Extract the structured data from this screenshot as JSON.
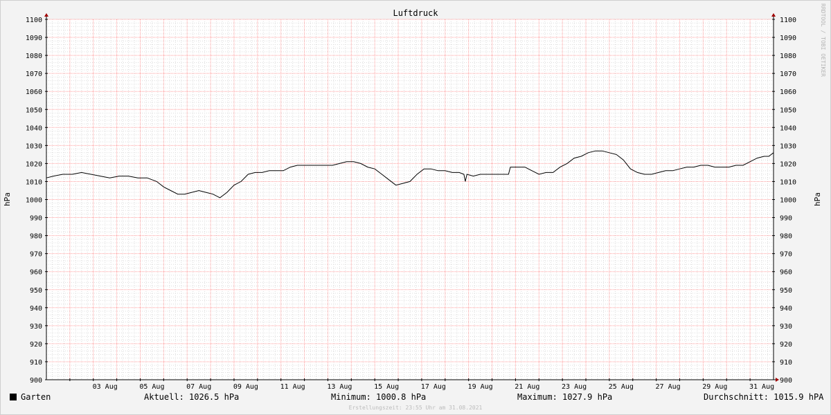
{
  "chart_data": {
    "type": "line",
    "title": "Luftdruck",
    "ylabel_left": "hPa",
    "ylabel_right": "hPa",
    "watermark": "RRDTOOL / TOBI OETIKER",
    "ylim": [
      900,
      1100
    ],
    "yticks": [
      900,
      910,
      920,
      930,
      940,
      950,
      960,
      970,
      980,
      990,
      1000,
      1010,
      1020,
      1030,
      1040,
      1050,
      1060,
      1070,
      1080,
      1090,
      1100
    ],
    "x_unit": "day of August 2021",
    "xlim": [
      1.0,
      32.0
    ],
    "xticks": [
      {
        "day": 3,
        "label": "03 Aug"
      },
      {
        "day": 5,
        "label": "05 Aug"
      },
      {
        "day": 7,
        "label": "07 Aug"
      },
      {
        "day": 9,
        "label": "09 Aug"
      },
      {
        "day": 11,
        "label": "11 Aug"
      },
      {
        "day": 13,
        "label": "13 Aug"
      },
      {
        "day": 15,
        "label": "15 Aug"
      },
      {
        "day": 17,
        "label": "17 Aug"
      },
      {
        "day": 19,
        "label": "19 Aug"
      },
      {
        "day": 21,
        "label": "21 Aug"
      },
      {
        "day": 23,
        "label": "23 Aug"
      },
      {
        "day": 25,
        "label": "25 Aug"
      },
      {
        "day": 27,
        "label": "27 Aug"
      },
      {
        "day": 29,
        "label": "29 Aug"
      },
      {
        "day": 31,
        "label": "31 Aug"
      }
    ],
    "grid": true,
    "series": [
      {
        "name": "Garten",
        "color": "#000000",
        "points": [
          [
            1.0,
            1012
          ],
          [
            1.3,
            1013
          ],
          [
            1.7,
            1014
          ],
          [
            2.1,
            1014
          ],
          [
            2.5,
            1015
          ],
          [
            2.9,
            1014
          ],
          [
            3.3,
            1013
          ],
          [
            3.7,
            1012
          ],
          [
            4.1,
            1013
          ],
          [
            4.5,
            1013
          ],
          [
            4.9,
            1012
          ],
          [
            5.3,
            1012
          ],
          [
            5.7,
            1010
          ],
          [
            6.0,
            1007
          ],
          [
            6.3,
            1005
          ],
          [
            6.6,
            1003
          ],
          [
            6.9,
            1003
          ],
          [
            7.2,
            1004
          ],
          [
            7.5,
            1005
          ],
          [
            7.8,
            1004
          ],
          [
            8.1,
            1003
          ],
          [
            8.4,
            1001
          ],
          [
            8.7,
            1004
          ],
          [
            9.0,
            1008
          ],
          [
            9.3,
            1010
          ],
          [
            9.6,
            1014
          ],
          [
            9.9,
            1015
          ],
          [
            10.2,
            1015
          ],
          [
            10.5,
            1016
          ],
          [
            10.8,
            1016
          ],
          [
            11.1,
            1016
          ],
          [
            11.4,
            1018
          ],
          [
            11.7,
            1019
          ],
          [
            12.0,
            1019
          ],
          [
            12.3,
            1019
          ],
          [
            12.6,
            1019
          ],
          [
            12.9,
            1019
          ],
          [
            13.2,
            1019
          ],
          [
            13.5,
            1020
          ],
          [
            13.8,
            1021
          ],
          [
            14.1,
            1021
          ],
          [
            14.4,
            1020
          ],
          [
            14.7,
            1018
          ],
          [
            15.0,
            1017
          ],
          [
            15.3,
            1014
          ],
          [
            15.6,
            1011
          ],
          [
            15.9,
            1008
          ],
          [
            16.2,
            1009
          ],
          [
            16.5,
            1010
          ],
          [
            16.8,
            1014
          ],
          [
            17.1,
            1017
          ],
          [
            17.4,
            1017
          ],
          [
            17.7,
            1016
          ],
          [
            18.0,
            1016
          ],
          [
            18.3,
            1015
          ],
          [
            18.6,
            1015
          ],
          [
            18.8,
            1014
          ],
          [
            18.86,
            1010
          ],
          [
            18.93,
            1014
          ],
          [
            19.2,
            1013
          ],
          [
            19.5,
            1014
          ],
          [
            19.8,
            1014
          ],
          [
            20.1,
            1014
          ],
          [
            20.4,
            1014
          ],
          [
            20.7,
            1014
          ],
          [
            20.78,
            1018
          ],
          [
            21.1,
            1018
          ],
          [
            21.4,
            1018
          ],
          [
            21.7,
            1016
          ],
          [
            22.0,
            1014
          ],
          [
            22.3,
            1015
          ],
          [
            22.6,
            1015
          ],
          [
            22.9,
            1018
          ],
          [
            23.2,
            1020
          ],
          [
            23.5,
            1023
          ],
          [
            23.8,
            1024
          ],
          [
            24.1,
            1026
          ],
          [
            24.4,
            1027
          ],
          [
            24.7,
            1027
          ],
          [
            25.0,
            1026
          ],
          [
            25.3,
            1025
          ],
          [
            25.6,
            1022
          ],
          [
            25.9,
            1017
          ],
          [
            26.2,
            1015
          ],
          [
            26.5,
            1014
          ],
          [
            26.8,
            1014
          ],
          [
            27.1,
            1015
          ],
          [
            27.4,
            1016
          ],
          [
            27.7,
            1016
          ],
          [
            28.0,
            1017
          ],
          [
            28.3,
            1018
          ],
          [
            28.6,
            1018
          ],
          [
            28.9,
            1019
          ],
          [
            29.2,
            1019
          ],
          [
            29.5,
            1018
          ],
          [
            29.8,
            1018
          ],
          [
            30.1,
            1018
          ],
          [
            30.4,
            1019
          ],
          [
            30.7,
            1019
          ],
          [
            31.0,
            1021
          ],
          [
            31.3,
            1023
          ],
          [
            31.6,
            1024
          ],
          [
            31.8,
            1024
          ],
          [
            32.0,
            1026
          ]
        ]
      }
    ]
  },
  "legend": {
    "series_name": "Garten",
    "current": "Aktuell: 1026.5 hPa",
    "minimum": "Minimum: 1000.8 hPa",
    "maximum": "Maximum: 1027.9 hPa",
    "average": "Durchschnitt: 1015.9 hPA"
  },
  "footer": "Erstellungszeit: 23:55 Uhr am 31.08.2021",
  "colors": {
    "background": "#f3f3f3",
    "plot_background": "#ffffff",
    "minor_grid": "#dcdcdc",
    "major_grid": "#ff9a9a",
    "axis": "#000000",
    "arrow": "#a00000",
    "line": "#000000"
  }
}
